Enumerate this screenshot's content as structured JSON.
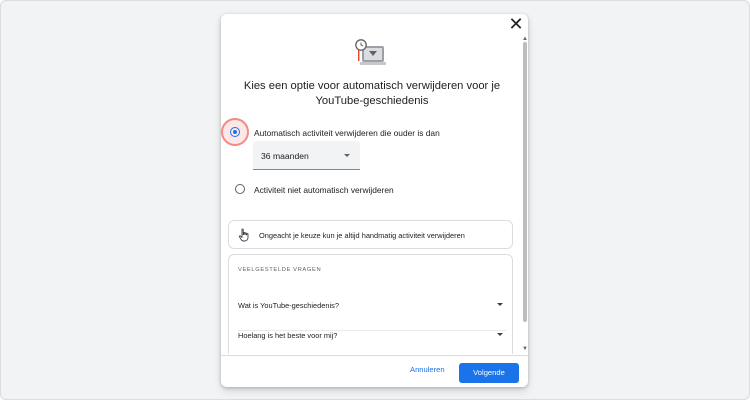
{
  "dialog": {
    "close_icon": "close-icon",
    "illustration_icon": "auto-delete-illustration",
    "title": "Kies een optie voor automatisch verwijderen voor je YouTube-geschiedenis"
  },
  "options": {
    "auto_delete": {
      "label": "Automatisch activiteit verwijderen die ouder is dan",
      "selected": true
    },
    "period_select": {
      "value": "36 maanden"
    },
    "no_auto_delete": {
      "label": "Activiteit niet automatisch verwijderen",
      "selected": false
    }
  },
  "info": {
    "icon": "hand-pointer-icon",
    "text": "Ongeacht je keuze kun je altijd handmatig activiteit verwijderen"
  },
  "faq": {
    "heading": "VEELGESTELDE VRAGEN",
    "items": [
      {
        "label": "Wat is YouTube-geschiedenis?"
      },
      {
        "label": "Hoelang is het beste voor mij?"
      }
    ]
  },
  "footer": {
    "cancel_label": "Annuleren",
    "next_label": "Volgende"
  },
  "colors": {
    "accent": "#1a73e8",
    "highlight": "#f28b82"
  }
}
